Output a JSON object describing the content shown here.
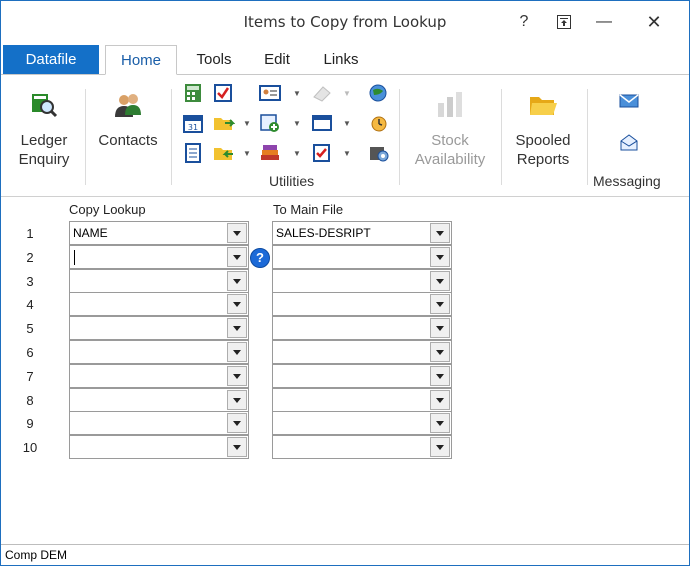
{
  "window": {
    "title": "Items to Copy from Lookup",
    "help_glyph": "?",
    "restore_glyph": "⊼",
    "minimize_glyph": "—",
    "close_glyph": "✕"
  },
  "tabs": [
    {
      "label": "Datafile"
    },
    {
      "label": "Home"
    },
    {
      "label": "Tools"
    },
    {
      "label": "Edit"
    },
    {
      "label": "Links"
    }
  ],
  "ribbon": {
    "ledger_enquiry": [
      "Ledger",
      "Enquiry"
    ],
    "contacts": "Contacts",
    "stock_availability": [
      "Stock",
      "Availability"
    ],
    "spooled_reports": [
      "Spooled",
      "Reports"
    ],
    "utilities_group": "Utilities",
    "messaging_group": "Messaging"
  },
  "columns": {
    "copy_lookup": "Copy Lookup",
    "to_main_file": "To Main File"
  },
  "rows": [
    {
      "num": "1",
      "lookup": "NAME",
      "main": "SALES-DESRIPT"
    },
    {
      "num": "2",
      "lookup": "",
      "main": ""
    },
    {
      "num": "3",
      "lookup": "",
      "main": ""
    },
    {
      "num": "4",
      "lookup": "",
      "main": ""
    },
    {
      "num": "5",
      "lookup": "",
      "main": ""
    },
    {
      "num": "6",
      "lookup": "",
      "main": ""
    },
    {
      "num": "7",
      "lookup": "",
      "main": ""
    },
    {
      "num": "8",
      "lookup": "",
      "main": ""
    },
    {
      "num": "9",
      "lookup": "",
      "main": ""
    },
    {
      "num": "10",
      "lookup": "",
      "main": ""
    }
  ],
  "help_icon": "?",
  "status": {
    "text": "Comp DEM"
  },
  "colors": {
    "accent": "#1470c8",
    "border": "#1e6fbf"
  }
}
